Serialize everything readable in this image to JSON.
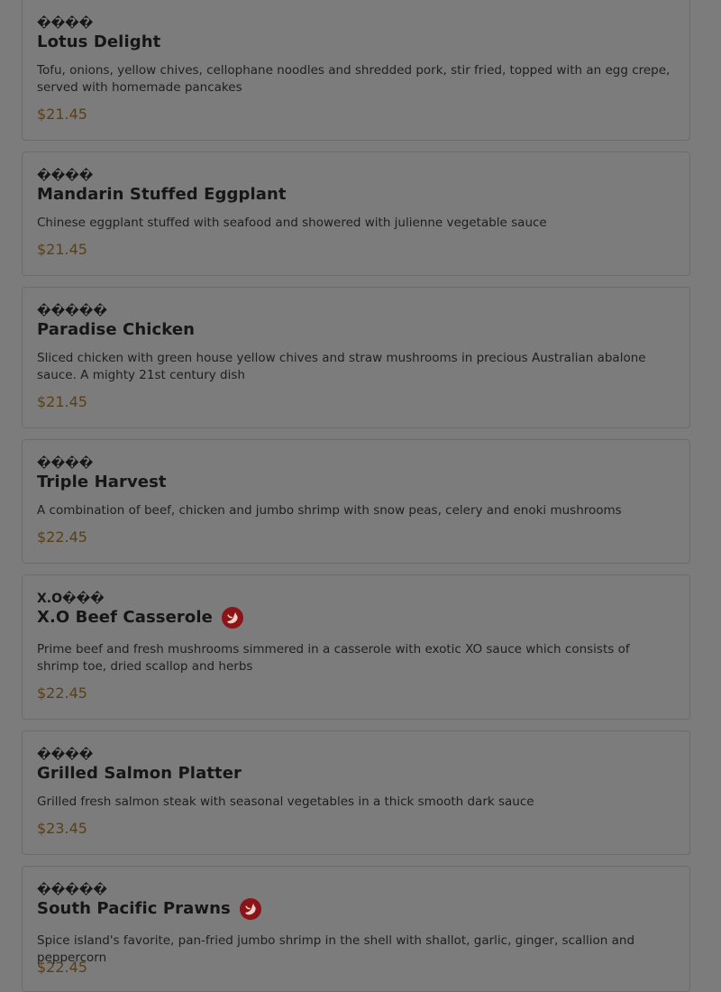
{
  "colors": {
    "overlay_bg": "#7c7c7c",
    "card_border": "#6b6b6b",
    "price": "#5a3f14",
    "spicy_icon": "#8b1418"
  },
  "items": [
    {
      "chinese": "����",
      "name": "Lotus Delight",
      "spicy": false,
      "description": "Tofu, onions, yellow chives, cellophane noodles and shredded pork, stir fried, topped with an egg crepe, served with homemade pancakes",
      "price": "$21.45"
    },
    {
      "chinese": "����",
      "name": "Mandarin Stuffed Eggplant",
      "spicy": false,
      "description": "Chinese eggplant stuffed with seafood and showered with julienne vegetable sauce",
      "price": "$21.45"
    },
    {
      "chinese": "�����",
      "name": "Paradise Chicken",
      "spicy": false,
      "description": "Sliced chicken with green house yellow chives and straw mushrooms in precious Australian abalone sauce. A mighty 21st century dish",
      "price": "$21.45"
    },
    {
      "chinese": "����",
      "name": "Triple Harvest",
      "spicy": false,
      "description": "A combination of beef, chicken and jumbo shrimp with snow peas, celery and enoki mushrooms",
      "price": "$22.45"
    },
    {
      "chinese": "X.O���",
      "name": "X.O Beef Casserole",
      "spicy": true,
      "spicy_icon": "chili-pepper-icon",
      "description": "Prime beef and fresh mushrooms simmered in a casserole with exotic XO sauce which consists of shrimp toe, dried scallop and herbs",
      "price": "$22.45"
    },
    {
      "chinese": "����",
      "name": "Grilled Salmon Platter",
      "spicy": false,
      "description": "Grilled fresh salmon steak with seasonal vegetables in a thick smooth dark sauce",
      "price": "$23.45"
    },
    {
      "chinese": "�����",
      "name": "South Pacific Prawns",
      "spicy": true,
      "spicy_icon": "chili-pepper-icon",
      "description": "Spice island's favorite, pan-fried jumbo shrimp in the shell with shallot, garlic, ginger, scallion and peppercorn",
      "price": "$22.45"
    }
  ]
}
